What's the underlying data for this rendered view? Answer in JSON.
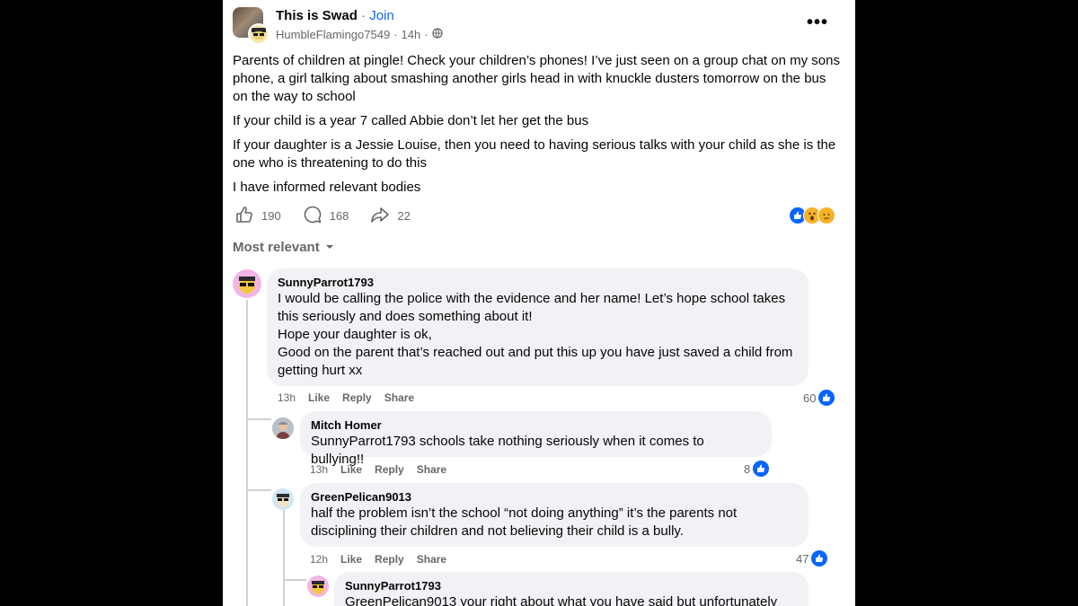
{
  "post": {
    "group_name": "This is Swad",
    "separator": "·",
    "join_label": "Join",
    "author": "HumbleFlamingo7549",
    "time": "14h",
    "meta_sep": "·",
    "paragraphs": [
      "Parents of children at pingle! Check your children’s phones! I’ve just seen on a group chat on my sons phone, a girl talking about smashing another girls head in with knuckle dusters tomorrow on the bus on the way to school",
      "If your child is a year 7 called Abbie don’t let her get the bus",
      "If your daughter is a Jessie Louise, then you need to having serious talks with your child as she is the one who is threatening to do this",
      "I have informed relevant bodies"
    ],
    "likes": "190",
    "comments": "168",
    "shares": "22",
    "more": "•••"
  },
  "sort_label": "Most relevant",
  "actions": {
    "like": "Like",
    "reply": "Reply",
    "share": "Share"
  },
  "comments": [
    {
      "author": "SunnyParrot1793",
      "lines": [
        "I would be calling the police with the evidence and her name! Let’s hope school takes this seriously and does something about it!",
        "Hope your daughter is ok,",
        "Good on the parent that’s reached out and put this up you have just saved a child from getting hurt xx"
      ],
      "time": "13h",
      "likes": "60"
    },
    {
      "author": "Mitch Homer",
      "text": "SunnyParrot1793 schools take nothing seriously when it comes to bullying!!",
      "time": "13h",
      "likes": "8"
    },
    {
      "author": "GreenPelican9013",
      "text": "half the problem isn’t the school “not doing anything” it’s the parents not disciplining their children and not believing their child is a bully.",
      "time": "12h",
      "likes": "47"
    },
    {
      "author": "SunnyParrot1793",
      "text": "GreenPelican9013 your right about what you have said but unfortunately"
    }
  ],
  "colors": {
    "accent": "#0866ff",
    "bubble": "#f0f2f5",
    "secondary_text": "#65676b"
  },
  "icons": [
    "globe-icon",
    "like-icon",
    "comment-icon",
    "share-icon",
    "chevron-down-icon",
    "more-icon"
  ]
}
